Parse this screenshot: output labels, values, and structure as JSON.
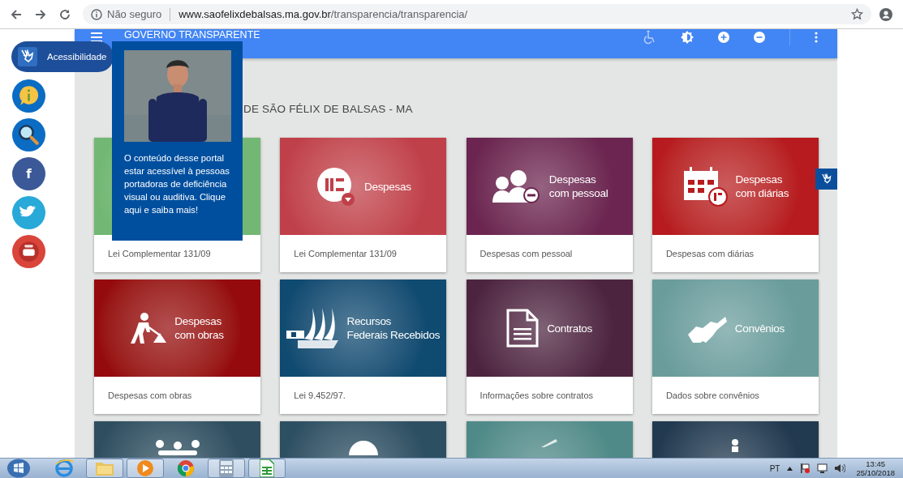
{
  "browser": {
    "security": "Não seguro",
    "url_host": "www.saofelixdebalsas.ma.gov.br",
    "url_path": "/transparencia/transparencia/"
  },
  "header": {
    "title": "GOVERNO TRANSPARENTE",
    "tools": [
      {
        "kind": "wheelchair",
        "disabled": true
      },
      {
        "kind": "contrast",
        "disabled": false
      },
      {
        "kind": "zoom-in",
        "disabled": false
      },
      {
        "kind": "zoom-out",
        "disabled": false
      },
      {
        "kind": "more",
        "disabled": false
      }
    ]
  },
  "accessibility": {
    "label": "Acessibilidade"
  },
  "side_buttons": [
    {
      "kind": "info",
      "color": "#0b6cc4"
    },
    {
      "kind": "search",
      "color": "#0b6cc4"
    },
    {
      "kind": "facebook",
      "color": "#3b5998",
      "glyph": "f"
    },
    {
      "kind": "twitter",
      "color": "#28a9d8"
    },
    {
      "kind": "youtube",
      "color": "#d9453b"
    }
  ],
  "popup": {
    "text": "O conteúdo desse portal estar acessível à pessoas portadoras de deficiência visual ou auditiva. Clique aqui e saiba mais!"
  },
  "page_title": "DE SÃO FÉLIX DE BALSAS - MA",
  "cards": [
    {
      "kind": "none",
      "color": "#72b874",
      "caption": "Lei Complementar 131/09"
    },
    {
      "kind": "money",
      "color": "#c0404a",
      "label": "Despesas",
      "caption": "Lei Complementar 131/09"
    },
    {
      "kind": "people",
      "color": "#6b2550",
      "label": "Despesas\ncom pessoal",
      "caption": "Despesas com pessoal"
    },
    {
      "kind": "calendar",
      "color": "#b71b1f",
      "label": "Despesas\ncom diárias",
      "caption": "Despesas com diárias"
    },
    {
      "kind": "worker",
      "color": "#950a0c",
      "label": "Despesas\ncom obras",
      "caption": "Despesas com obras"
    },
    {
      "kind": "columns",
      "color": "#0f4a70",
      "label": "Recursos\nFederais Recebidos",
      "caption": "Lei 9.452/97."
    },
    {
      "kind": "document",
      "color": "#4d2440",
      "label": "Contratos",
      "caption": "Informações sobre contratos"
    },
    {
      "kind": "handshake",
      "color": "#6a9c9c",
      "label": "Convênios",
      "caption": "Dados sobre convênios"
    },
    {
      "kind": "group",
      "color": "#2f4f60"
    },
    {
      "kind": "ball",
      "color": "#2d4f62"
    },
    {
      "kind": "pen",
      "color": "#4f8a88"
    },
    {
      "kind": "person",
      "color": "#223a50"
    }
  ],
  "taskbar": {
    "apps": [
      {
        "kind": "browser-e",
        "open": false
      },
      {
        "kind": "folder",
        "open": true
      },
      {
        "kind": "media",
        "open": true
      },
      {
        "kind": "chrome",
        "open": false
      },
      {
        "kind": "calculator",
        "open": true
      },
      {
        "kind": "spreadsheet",
        "open": true
      }
    ],
    "language": "PT",
    "time": "13:45",
    "date": "25/10/2018"
  }
}
